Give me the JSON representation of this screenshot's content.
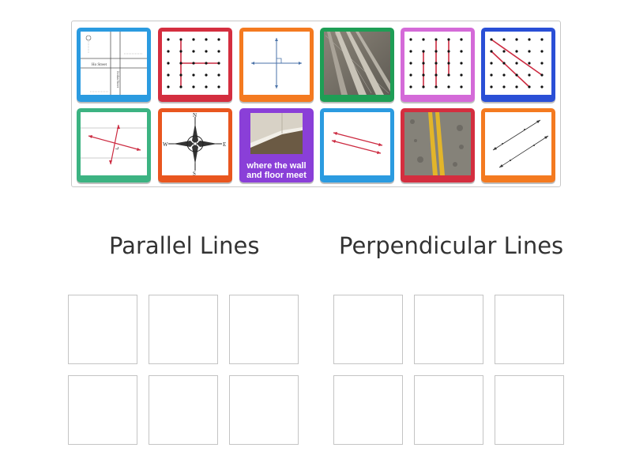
{
  "colors": {
    "blue": "#2b9be0",
    "red": "#d42e3f",
    "orange": "#f47a20",
    "green": "#1e9e55",
    "pink": "#d46ad8",
    "navy": "#2a4fd6",
    "teal": "#3cb382",
    "orange_red": "#e9561f",
    "purple": "#8a3fd8"
  },
  "cards": [
    {
      "id": 1,
      "color": "blue",
      "content": "street-map",
      "text": "Ho Street",
      "text_vertical": "Jordan Street"
    },
    {
      "id": 2,
      "color": "red",
      "content": "geoboard-perpendicular"
    },
    {
      "id": 3,
      "color": "orange",
      "content": "perpendicular-axes"
    },
    {
      "id": 4,
      "color": "green",
      "content": "railroad-track-photo"
    },
    {
      "id": 5,
      "color": "pink",
      "content": "geoboard-vertical-parallel"
    },
    {
      "id": 6,
      "color": "navy",
      "content": "geoboard-diagonal-parallel"
    },
    {
      "id": 7,
      "color": "teal",
      "content": "crossing-arrows"
    },
    {
      "id": 8,
      "color": "orange_red",
      "content": "compass-rose",
      "compass": [
        "N",
        "W",
        "E",
        "S"
      ]
    },
    {
      "id": 9,
      "color": "purple",
      "content": "wall-floor-corner-photo",
      "caption": "where the wall and floor meet"
    },
    {
      "id": 10,
      "color": "blue",
      "content": "parallel-arrows"
    },
    {
      "id": 11,
      "color": "red",
      "content": "road-yellow-lines-photo"
    },
    {
      "id": 12,
      "color": "orange",
      "content": "labeled-parallel-lines"
    }
  ],
  "groups": [
    {
      "title": "Parallel Lines"
    },
    {
      "title": "Perpendicular Lines"
    }
  ]
}
